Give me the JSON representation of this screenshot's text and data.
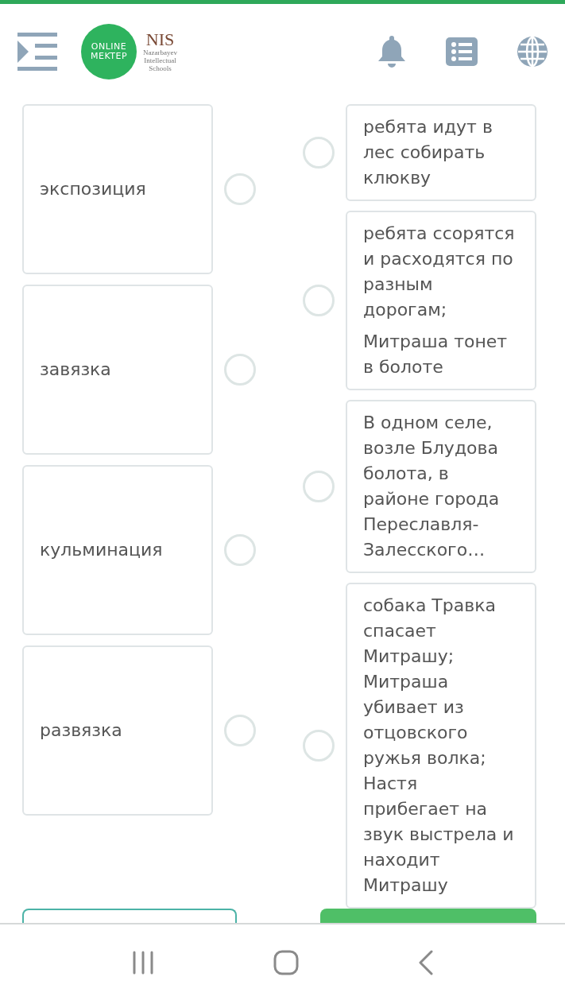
{
  "header": {
    "logo_main": [
      "ONLINE",
      "MEKTEP"
    ],
    "logo_brand": "NIS",
    "logo_caption": [
      "Nazarbayev",
      "Intellectual",
      "Schools"
    ]
  },
  "terms": [
    {
      "label": "экспозиция",
      "selected": false
    },
    {
      "label": "завязка",
      "selected": false
    },
    {
      "label": "кульминация",
      "selected": false
    },
    {
      "label": "развязка",
      "selected": false
    }
  ],
  "events": [
    {
      "paragraphs": [
        "ребята идут в лес собирать клюкву"
      ],
      "selected": false
    },
    {
      "paragraphs": [
        "ребята ссорятся и расходятся по разным дорогам;",
        "Митраша тонет в болоте"
      ],
      "selected": false
    },
    {
      "paragraphs": [
        "В одном селе, возле Блудова болота, в районе города Переславля-Залесского…"
      ],
      "selected": false
    },
    {
      "paragraphs": [
        "собака Травка спасает Митрашу; Митраша убивает из отцовского ружья волка; Настя прибегает на звук выстрела и находит Митрашу"
      ],
      "selected": false
    }
  ]
}
